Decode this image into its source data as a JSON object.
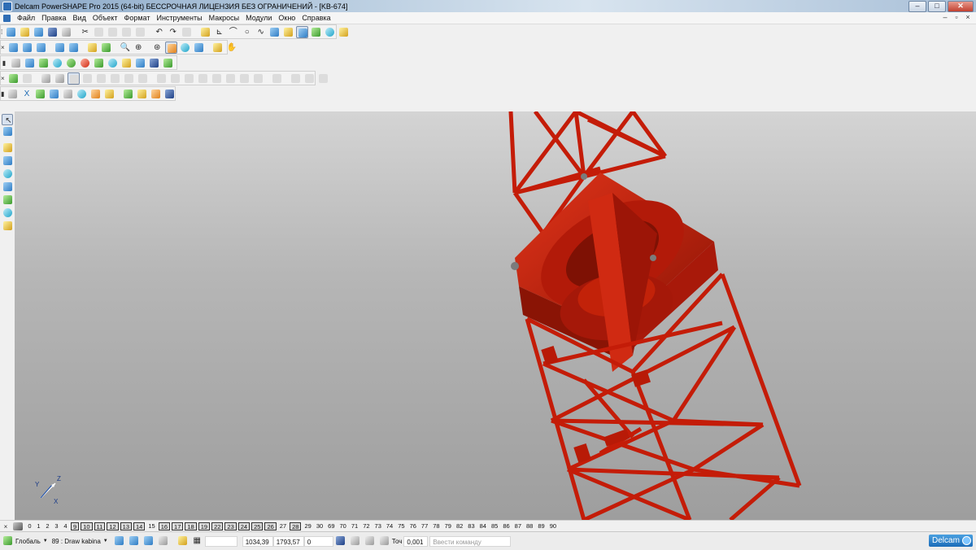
{
  "window": {
    "title": "Delcam PowerSHAPE Pro 2015 (64-bit) БЕССРОЧНАЯ ЛИЦЕНЗИЯ БЕЗ ОГРАНИЧЕНИЙ - [KB-674]",
    "controls": [
      "–",
      "□",
      "✕"
    ]
  },
  "menu": {
    "items": [
      "Файл",
      "Правка",
      "Вид",
      "Объект",
      "Формат",
      "Инструменты",
      "Макросы",
      "Модули",
      "Окно",
      "Справка"
    ],
    "mdi_controls": [
      "–",
      "▫",
      "×"
    ]
  },
  "toolbars": {
    "row1_icons": [
      "new-file",
      "open-file",
      "open-model",
      "save",
      "print",
      "cut",
      "copy",
      "paste",
      "paint",
      "clear",
      "undo",
      "redo",
      "redo-repeat",
      "select-zoom",
      "axis-icon",
      "curve-icon",
      "circle-icon",
      "spline-icon",
      "surface-icon",
      "shading-icon",
      "solid-icon",
      "shaded-view",
      "wire-view",
      "magic-wand"
    ],
    "row2_icons": [
      "view-top",
      "view-front",
      "view-side",
      "view-iso",
      "view-iso2",
      "rotate",
      "zoom",
      "zoom-fit",
      "pan",
      "globe",
      "shaded",
      "wire",
      "dynamic",
      "hand"
    ],
    "row3_icons": [
      "model-icon",
      "doc-icon",
      "layer-icon",
      "sphere-cyan",
      "sphere-green",
      "sphere-red",
      "cone",
      "cone-green",
      "box-yellow",
      "solid-blue",
      "surface-blue",
      "arrow-green"
    ],
    "row4_icons": [
      "pick-icon",
      "bullet-icon",
      "sphere-gray",
      "cube-pressed",
      "cube",
      "rotate-small",
      "swap",
      "grid-small",
      "box-small",
      "pale-1",
      "pale-2",
      "pale-3",
      "pale-4",
      "pale-5",
      "pale-6",
      "pale-7",
      "pale-8",
      "pale-9",
      "pale-10",
      "pale-11",
      "pale-12"
    ],
    "row5_icons": [
      "sphere-small",
      "x-axis",
      "cube-green",
      "cube-blue",
      "cube-gray",
      "cube-bright",
      "cube-orange",
      "cube-yellow",
      "curve-green",
      "curve-yellow",
      "cube-multi",
      "ramp-blue"
    ]
  },
  "left_toolbar": {
    "icons": [
      "select-arrow-icon",
      "selection-options-icon",
      "layers-icon",
      "solids-icon",
      "surfaces-icon",
      "blend-icon",
      "feature-icon",
      "sweep-icon",
      "analysis-icon"
    ]
  },
  "viewport": {
    "axis_labels": {
      "x": "X",
      "y": "Y",
      "z": "Z"
    },
    "model_color": "#c81e08"
  },
  "levels": {
    "values": [
      "0",
      "1",
      "2",
      "3",
      "4",
      "9",
      "10",
      "11",
      "12",
      "13",
      "14",
      "15",
      "16",
      "17",
      "18",
      "19",
      "22",
      "23",
      "24",
      "25",
      "26",
      "27",
      "28",
      "29",
      "30",
      "69",
      "70",
      "71",
      "72",
      "73",
      "74",
      "75",
      "76",
      "77",
      "78",
      "79",
      "82",
      "83",
      "84",
      "85",
      "86",
      "87",
      "88",
      "89",
      "90"
    ],
    "boxed": [
      "9",
      "10",
      "11",
      "12",
      "13",
      "14",
      "16",
      "17",
      "18",
      "19",
      "22",
      "23",
      "24",
      "25",
      "26",
      "28"
    ]
  },
  "status": {
    "workplane": "Глобаль",
    "level": "89 : Draw kabina",
    "coord_x": "1034,39",
    "coord_y": "1793,57",
    "coord_z": "0",
    "tolerance_label": "Точ",
    "tolerance_value": "0,001",
    "command_placeholder": "Ввести команду",
    "logo": "Delcam"
  }
}
